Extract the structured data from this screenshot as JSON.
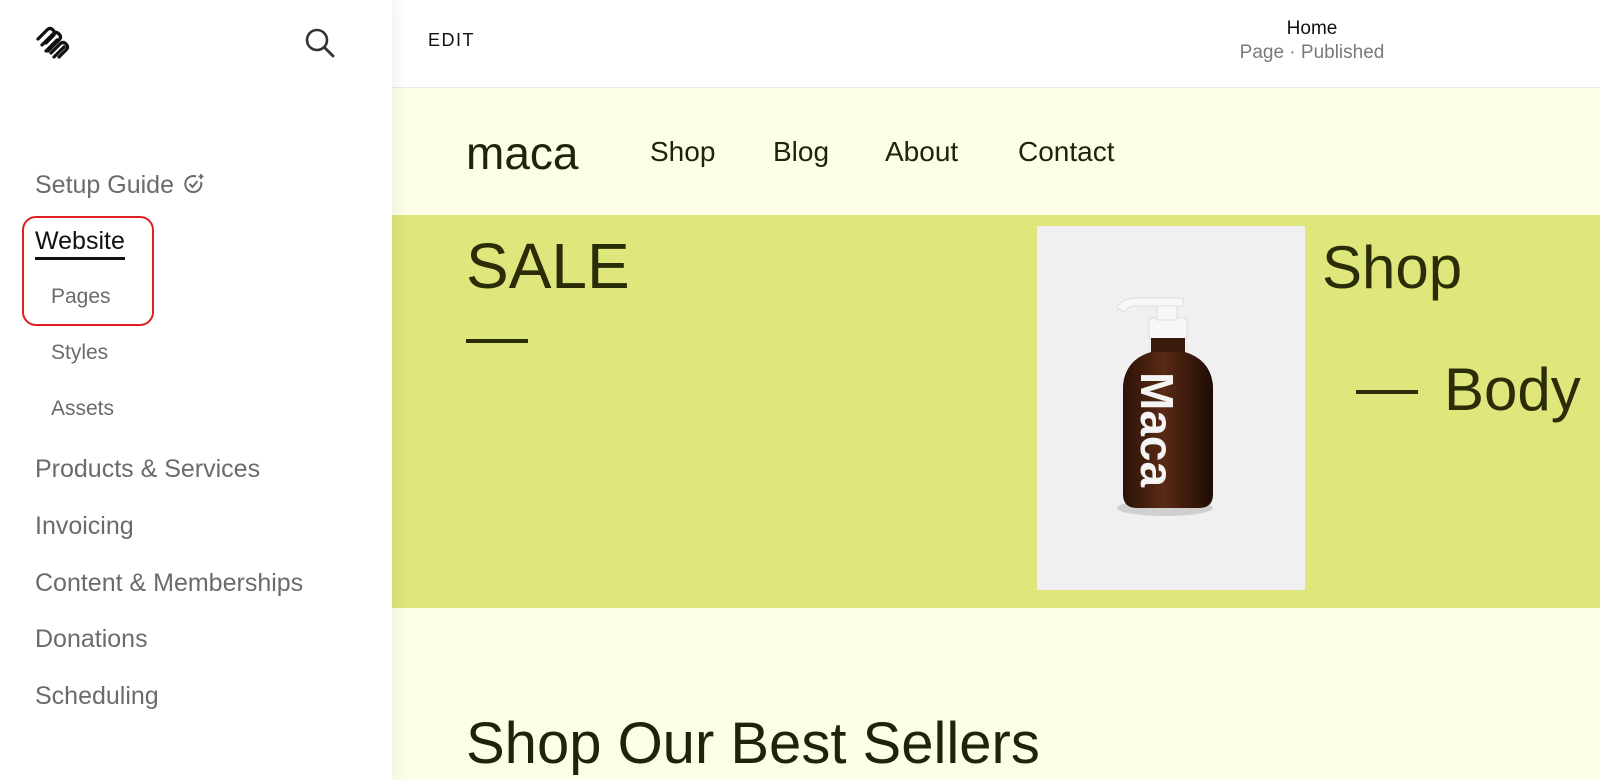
{
  "sidebar": {
    "items": [
      {
        "label": "Setup Guide"
      },
      {
        "label": "Website"
      },
      {
        "label": "Pages"
      },
      {
        "label": "Styles"
      },
      {
        "label": "Assets"
      },
      {
        "label": "Products & Services"
      },
      {
        "label": "Invoicing"
      },
      {
        "label": "Content & Memberships"
      },
      {
        "label": "Donations"
      },
      {
        "label": "Scheduling"
      }
    ],
    "active_item": "Website",
    "highlight_color": "#e02020"
  },
  "topbar": {
    "edit_label": "EDIT",
    "page_title": "Home",
    "page_status": "Page · Published"
  },
  "site": {
    "logo": "maca",
    "nav": [
      "Shop",
      "Blog",
      "About",
      "Contact"
    ],
    "hero": {
      "sale_title": "SALE",
      "shop_text": "Shop",
      "body_text": "Body",
      "bottle_label": "Maca"
    },
    "section_title": "Shop Our Best Sellers",
    "colors": {
      "header_bg": "#fcfee8",
      "hero_bg": "#dfe67b",
      "text_dark": "#2a2d08"
    }
  },
  "icons": [
    "squarespace-logo-icon",
    "search-icon",
    "setup-progress-icon"
  ]
}
